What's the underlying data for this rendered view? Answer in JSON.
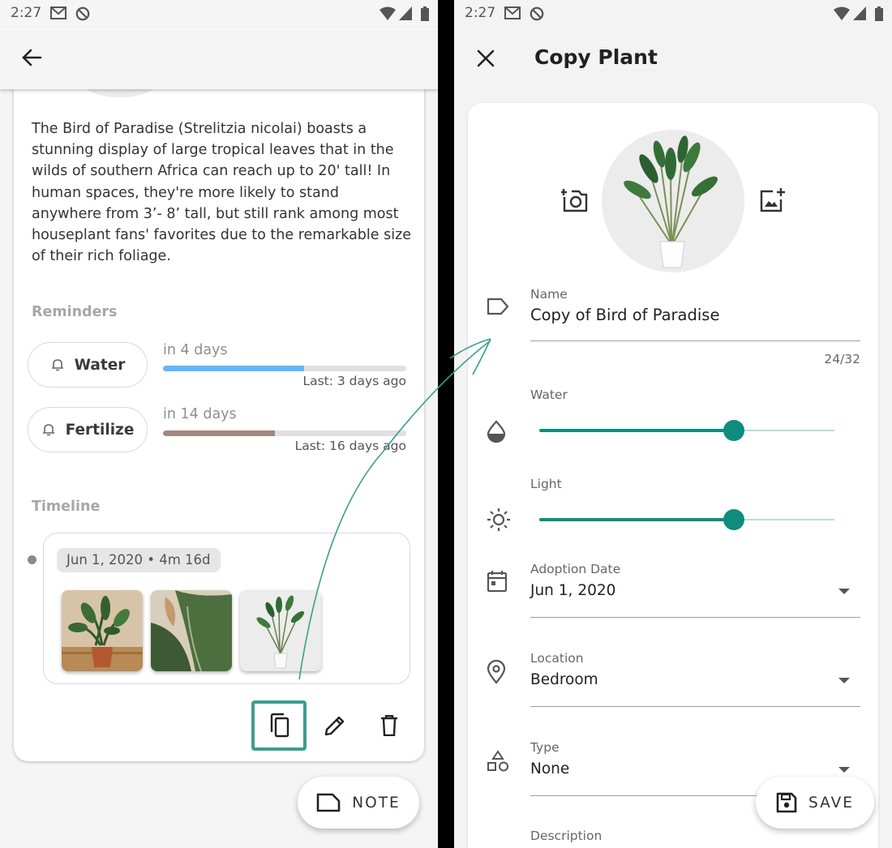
{
  "left_screen": {
    "status": {
      "time": "2:27"
    },
    "description": "The Bird of Paradise (Strelitzia nicolai) boasts a stunning display of large tropical leaves that in the wilds of southern Africa can reach up to 20' tall! In human spaces, they're more likely to stand anywhere from 3’- 8’ tall, but still rank among most houseplant fans' favorites due to the remarkable size of their rich foliage.",
    "reminders": {
      "title": "Reminders",
      "items": [
        {
          "label": "Water",
          "due": "in 4 days",
          "last": "Last: 3 days ago",
          "progress": 0.58,
          "color": "#64b5f6"
        },
        {
          "label": "Fertilize",
          "due": "in 14 days",
          "last": "Last: 16 days ago",
          "progress": 0.46,
          "color": "#a1887f"
        }
      ]
    },
    "timeline": {
      "title": "Timeline",
      "entry_date": "Jun 1, 2020 • 4m 16d"
    },
    "note_button": "NOTE"
  },
  "right_screen": {
    "status": {
      "time": "2:27"
    },
    "title": "Copy Plant",
    "name_field": {
      "label": "Name",
      "value": "Copy of Bird of Paradise",
      "counter": "24/32"
    },
    "water": {
      "label": "Water",
      "level": 0.66
    },
    "light": {
      "label": "Light",
      "level": 0.66
    },
    "adoption_date": {
      "label": "Adoption Date",
      "value": "Jun 1, 2020"
    },
    "location": {
      "label": "Location",
      "value": "Bedroom"
    },
    "type": {
      "label": "Type",
      "value": "None"
    },
    "description_label": "Description",
    "save_button": "SAVE"
  },
  "colors": {
    "accent": "#0e8c7c",
    "highlight": "#3b9e8e"
  }
}
